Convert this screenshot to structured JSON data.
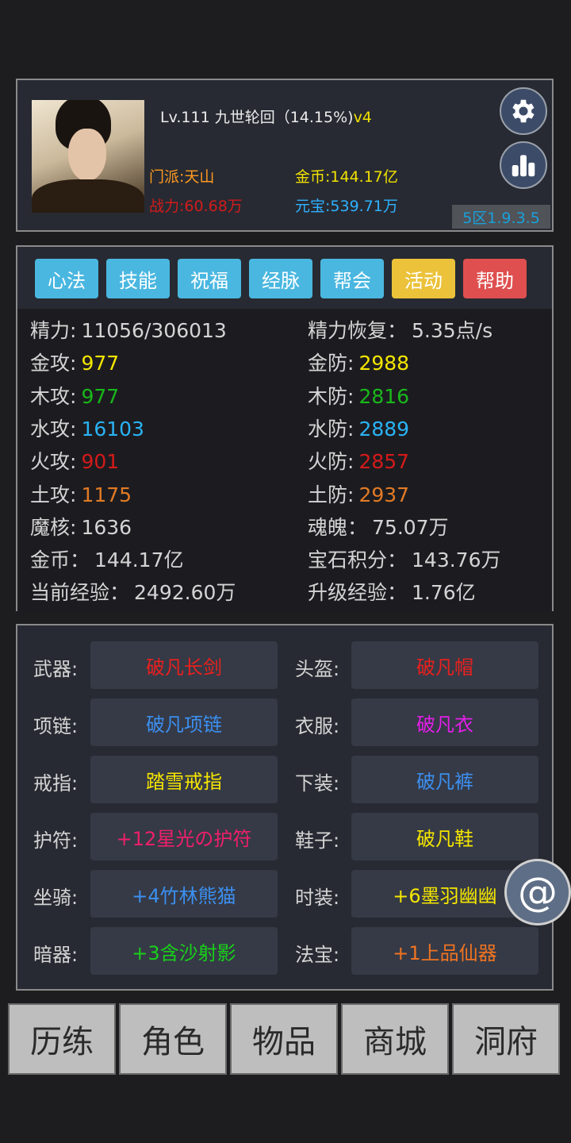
{
  "header": {
    "level_text": "Lv.111 九世轮回（14.15%)",
    "level_suffix": "v4",
    "sect": "门派:天山",
    "power": "战力:60.68万",
    "gold": "金币:144.17亿",
    "yuanbao": "元宝:539.71万",
    "version": "5区1.9.3.5",
    "settings_icon": "gear-icon",
    "stats_icon": "bar-chart-icon"
  },
  "tabs": [
    {
      "label": "心法",
      "color": "#4ab7e0"
    },
    {
      "label": "技能",
      "color": "#4ab7e0"
    },
    {
      "label": "祝福",
      "color": "#4ab7e0"
    },
    {
      "label": "经脉",
      "color": "#4ab7e0"
    },
    {
      "label": "帮会",
      "color": "#4ab7e0"
    },
    {
      "label": "活动",
      "color": "#ebc23a"
    },
    {
      "label": "帮助",
      "color": "#df4f4f"
    }
  ],
  "stats": [
    {
      "label": "精力:",
      "value": "11056/306013",
      "color": "#d4d4d4"
    },
    {
      "label": "精力恢复：",
      "value": "5.35点/s",
      "color": "#d4d4d4"
    },
    {
      "label": "金攻:",
      "value": "977",
      "color": "#f5e600"
    },
    {
      "label": "金防:",
      "value": "2988",
      "color": "#f5e600"
    },
    {
      "label": "木攻:",
      "value": "977",
      "color": "#19b81a"
    },
    {
      "label": "木防:",
      "value": "2816",
      "color": "#19b81a"
    },
    {
      "label": "水攻:",
      "value": "16103",
      "color": "#2ab3f5"
    },
    {
      "label": "水防:",
      "value": "2889",
      "color": "#2ab3f5"
    },
    {
      "label": "火攻:",
      "value": "901",
      "color": "#d41a1a"
    },
    {
      "label": "火防:",
      "value": "2857",
      "color": "#d41a1a"
    },
    {
      "label": "土攻:",
      "value": "1175",
      "color": "#e27a25"
    },
    {
      "label": "土防:",
      "value": "2937",
      "color": "#e27a25"
    },
    {
      "label": "魔核:",
      "value": "1636",
      "color": "#d4d4d4"
    },
    {
      "label": "魂魄：",
      "value": "75.07万",
      "color": "#d4d4d4"
    },
    {
      "label": "金币：",
      "value": "144.17亿",
      "color": "#d4d4d4"
    },
    {
      "label": "宝石积分：",
      "value": "143.76万",
      "color": "#d4d4d4"
    },
    {
      "label": "当前经验：",
      "value": "2492.60万",
      "color": "#d4d4d4"
    },
    {
      "label": "升级经验：",
      "value": "1.76亿",
      "color": "#d4d4d4"
    }
  ],
  "equipment": [
    {
      "label": "武器:",
      "item": "破凡长剑",
      "color": "#e8201e"
    },
    {
      "label": "头盔:",
      "item": "破凡帽",
      "color": "#e8201e"
    },
    {
      "label": "项链:",
      "item": "破凡项链",
      "color": "#3c8ff0"
    },
    {
      "label": "衣服:",
      "item": "破凡衣",
      "color": "#e41ee8"
    },
    {
      "label": "戒指:",
      "item": "踏雪戒指",
      "color": "#f5e600"
    },
    {
      "label": "下装:",
      "item": "破凡裤",
      "color": "#3c8ff0"
    },
    {
      "label": "护符:",
      "item": "+12星光の护符",
      "color": "#ef1f6a"
    },
    {
      "label": "鞋子:",
      "item": "破凡鞋",
      "color": "#f5e600"
    },
    {
      "label": "坐骑:",
      "item": "+4竹林熊猫",
      "color": "#3c8ff0"
    },
    {
      "label": "时装:",
      "item": "+6墨羽幽幽",
      "color": "#f5e600"
    },
    {
      "label": "暗器:",
      "item": "+3含沙射影",
      "color": "#19d01a"
    },
    {
      "label": "法宝:",
      "item": "+1上品仙器",
      "color": "#f07422"
    }
  ],
  "nav": [
    "历练",
    "角色",
    "物品",
    "商城",
    "洞府"
  ],
  "float_button": "@"
}
